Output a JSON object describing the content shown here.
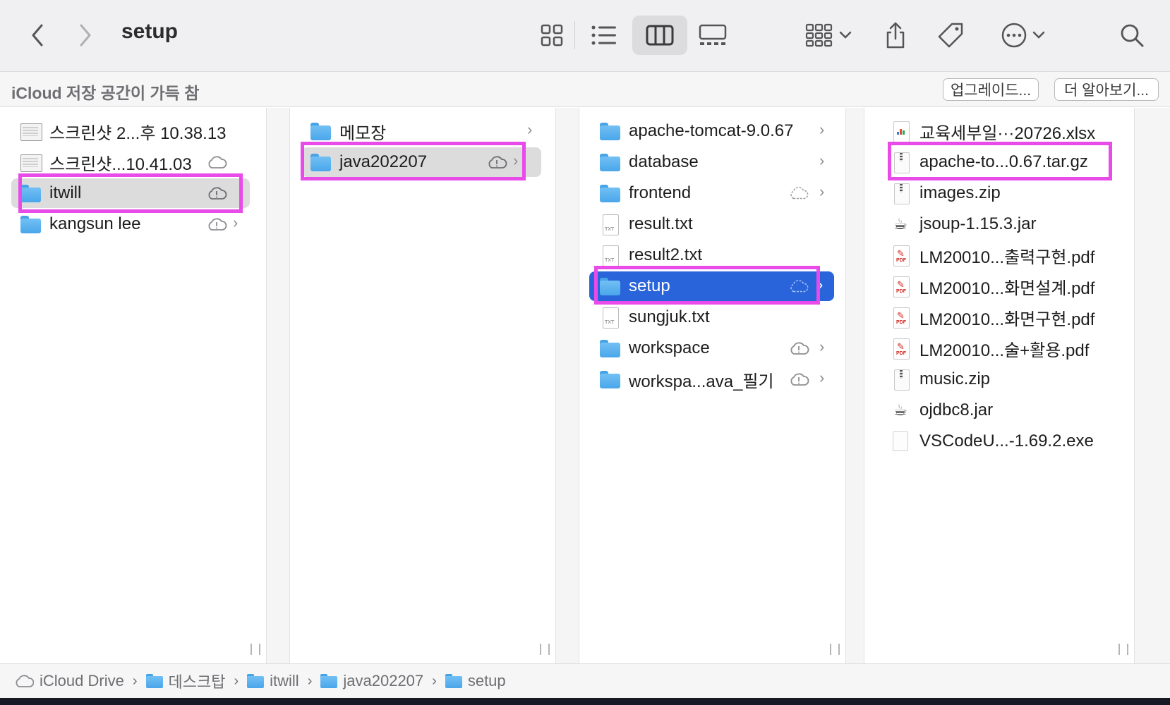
{
  "toolbar": {
    "title": "setup",
    "back_icon": "chevron-left-icon",
    "forward_icon": "chevron-right-icon",
    "view_modes": [
      "icon-view",
      "list-view",
      "column-view",
      "gallery-view"
    ],
    "active_view": "column-view",
    "group_icon": "group-icon",
    "share_icon": "share-icon",
    "tag_icon": "tag-icon",
    "more_icon": "ellipsis-circle-icon",
    "search_icon": "search-icon"
  },
  "banner": {
    "text": "iCloud 저장 공간이 가득 참",
    "upgrade_label": "업그레이드...",
    "learn_more_label": "더 알아보기..."
  },
  "columns": [
    {
      "items": [
        {
          "name": "스크린샷 2...후 10.38.13",
          "icon": "screenshot-icon",
          "status": "",
          "chevron": false
        },
        {
          "name": "스크린샷...10.41.03",
          "icon": "screenshot-icon",
          "status": "cloud",
          "chevron": false
        },
        {
          "name": "itwill",
          "icon": "folder-icon",
          "status": "cloud-alert",
          "chevron": false,
          "selected": true
        },
        {
          "name": "kangsun lee",
          "icon": "folder-icon",
          "status": "cloud-alert",
          "chevron": true
        }
      ]
    },
    {
      "items": [
        {
          "name": "메모장",
          "icon": "folder-icon",
          "status": "",
          "chevron": true
        },
        {
          "name": "java202207",
          "icon": "folder-icon",
          "status": "cloud-alert",
          "chevron": true,
          "selected": true
        }
      ]
    },
    {
      "items": [
        {
          "name": "apache-tomcat-9.0.67",
          "icon": "folder-icon",
          "status": "",
          "chevron": true
        },
        {
          "name": "database",
          "icon": "folder-icon",
          "status": "",
          "chevron": true
        },
        {
          "name": "frontend",
          "icon": "folder-icon",
          "status": "cloud-dashed",
          "chevron": true
        },
        {
          "name": "result.txt",
          "icon": "txt-file-icon",
          "status": "",
          "chevron": false
        },
        {
          "name": "result2.txt",
          "icon": "txt-file-icon",
          "status": "",
          "chevron": false
        },
        {
          "name": "setup",
          "icon": "folder-icon",
          "status": "cloud-dashed",
          "chevron": true,
          "selected": true
        },
        {
          "name": "sungjuk.txt",
          "icon": "txt-file-icon",
          "status": "",
          "chevron": false
        },
        {
          "name": "workspace",
          "icon": "folder-icon",
          "status": "cloud-alert",
          "chevron": true
        },
        {
          "name": "workspa...ava_필기",
          "icon": "folder-icon",
          "status": "cloud-alert",
          "chevron": true
        }
      ]
    },
    {
      "items": [
        {
          "name": "교육세부일···20726.xlsx",
          "icon": "xlsx-file-icon"
        },
        {
          "name": "apache-to...0.67.tar.gz",
          "icon": "archive-file-icon"
        },
        {
          "name": "images.zip",
          "icon": "archive-file-icon"
        },
        {
          "name": "jsoup-1.15.3.jar",
          "icon": "jar-file-icon"
        },
        {
          "name": "LM20010...출력구현.pdf",
          "icon": "pdf-file-icon"
        },
        {
          "name": "LM20010...화면설계.pdf",
          "icon": "pdf-file-icon"
        },
        {
          "name": "LM20010...화면구현.pdf",
          "icon": "pdf-file-icon"
        },
        {
          "name": "LM20010...술+활용.pdf",
          "icon": "pdf-file-icon"
        },
        {
          "name": "music.zip",
          "icon": "archive-file-icon"
        },
        {
          "name": "ojdbc8.jar",
          "icon": "jar-file-icon"
        },
        {
          "name": "VSCodeU...-1.69.2.exe",
          "icon": "generic-file-icon"
        }
      ]
    }
  ],
  "pathbar": {
    "items": [
      "iCloud Drive",
      "데스크탑",
      "itwill",
      "java202207",
      "setup"
    ]
  },
  "colors": {
    "selection_blue": "#2a64db",
    "selection_gray": "#dcdcdc",
    "highlight_magenta": "#e94be9",
    "folder_blue": "#5ab0ee"
  }
}
